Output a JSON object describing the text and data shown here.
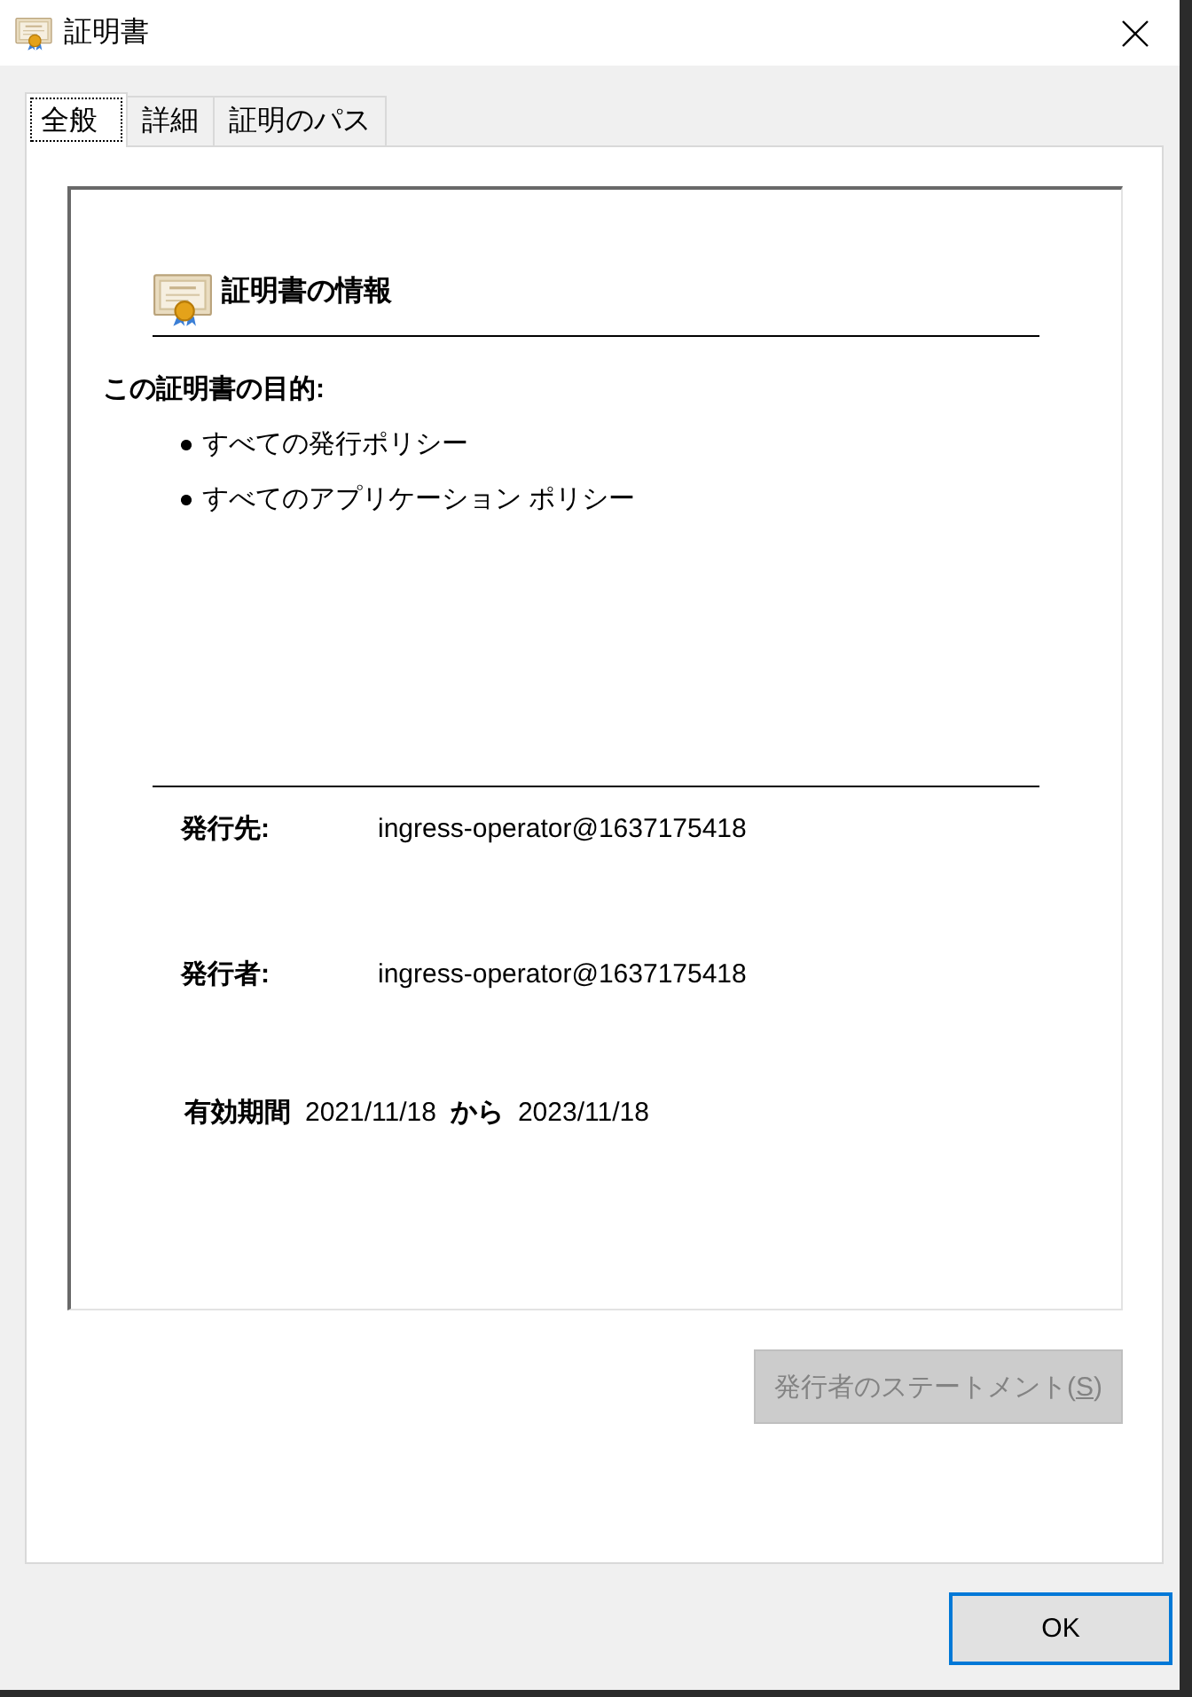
{
  "window": {
    "title": "証明書"
  },
  "tabs": [
    {
      "label": "全般",
      "selected": true
    },
    {
      "label": "詳細",
      "selected": false
    },
    {
      "label": "証明のパス",
      "selected": false
    }
  ],
  "info": {
    "heading": "証明書の情報",
    "purpose_label": "この証明書の目的:",
    "purposes": [
      "すべての発行ポリシー",
      "すべてのアプリケーション ポリシー"
    ],
    "issued_to_label": "発行先:",
    "issued_to": "ingress-operator@1637175418",
    "issued_by_label": "発行者:",
    "issued_by": "ingress-operator@1637175418",
    "validity_label": "有効期間",
    "valid_from": "2021/11/18",
    "from_word": "から",
    "valid_to": "2023/11/18"
  },
  "statement_button": {
    "label_before": "発行者のステートメント(",
    "mnemonic": "S",
    "label_after": ")",
    "disabled": true
  },
  "ok_button": {
    "label": "OK"
  }
}
